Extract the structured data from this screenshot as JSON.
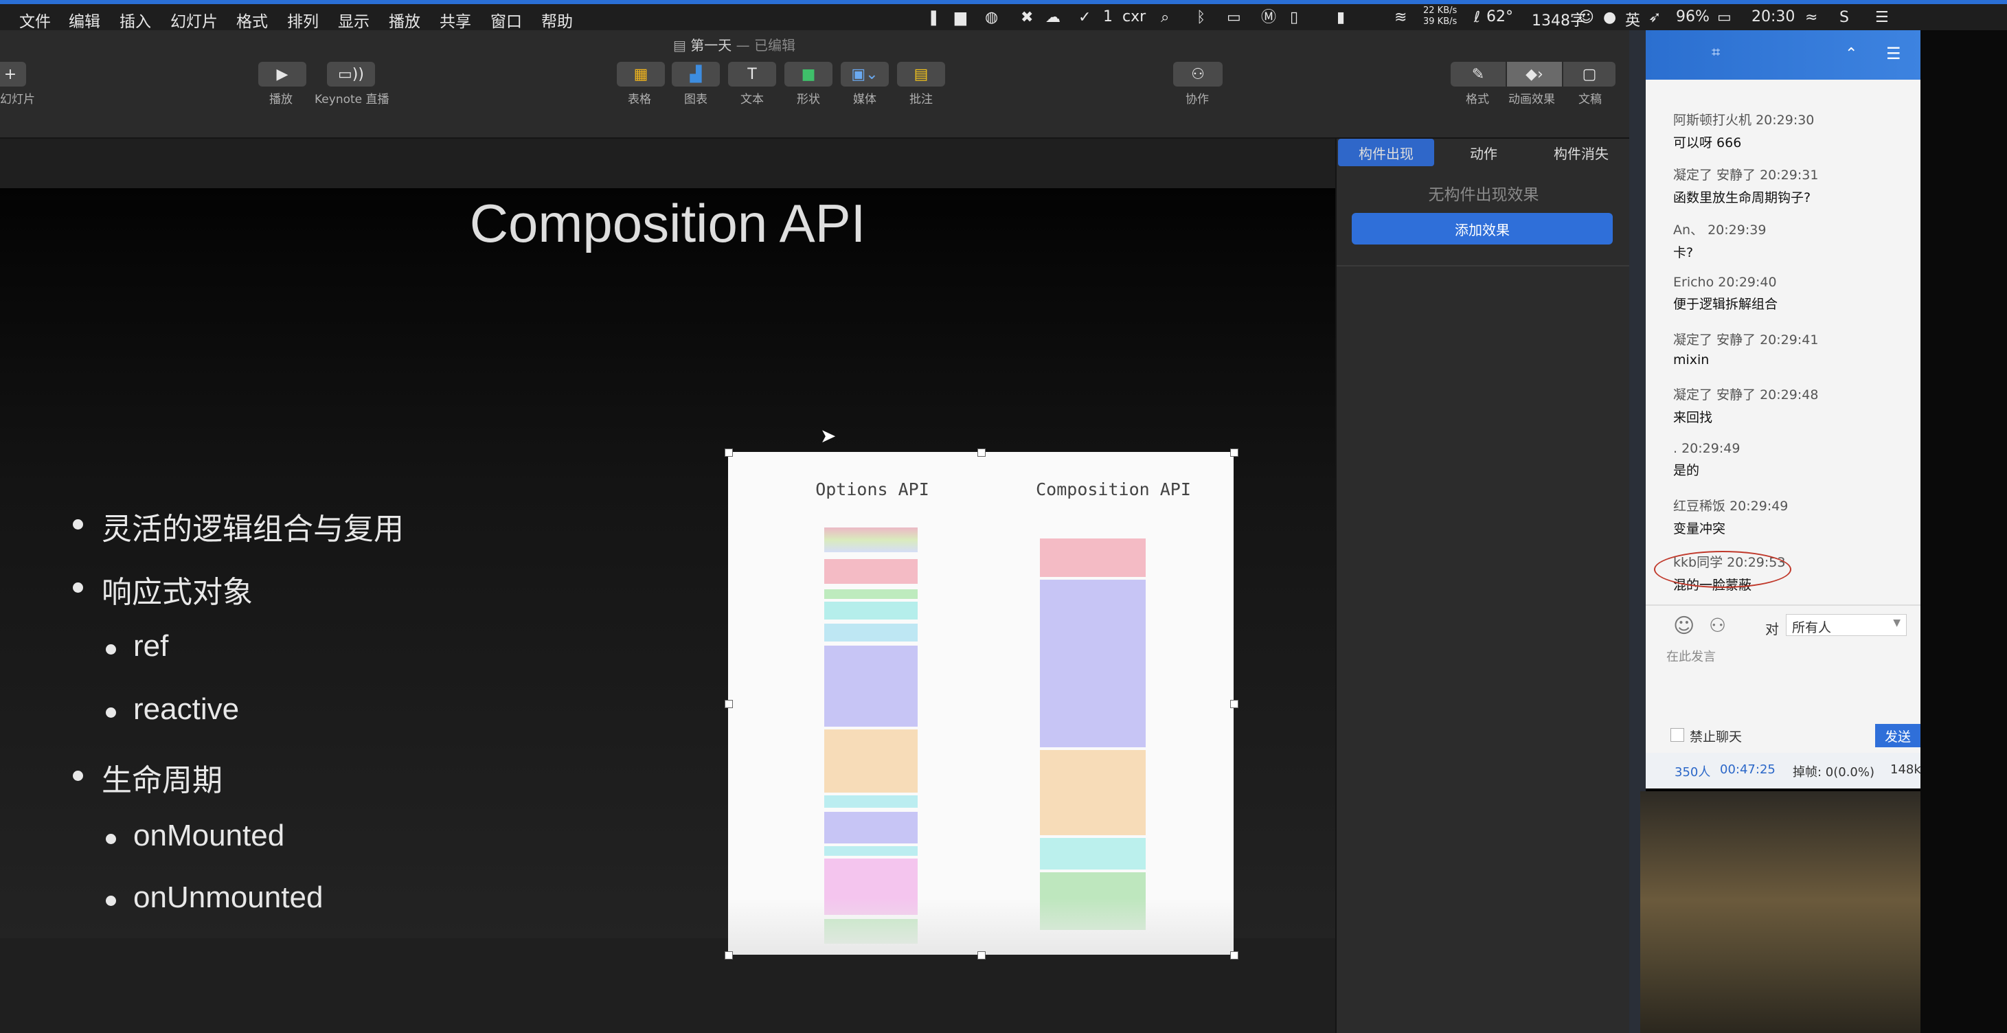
{
  "menubar": {
    "items": [
      "文件",
      "编辑",
      "插入",
      "幻灯片",
      "格式",
      "排列",
      "显示",
      "播放",
      "共享",
      "窗口",
      "帮助"
    ],
    "status": {
      "check_count": "1",
      "user": "cxr",
      "net_up": "22 KB/s",
      "net_down": "39 KB/s",
      "temp": "62°",
      "words": "1348字",
      "ime": "英",
      "battery": "96%",
      "time": "20:30"
    }
  },
  "window": {
    "title": "第一天",
    "edited": "— 已编辑"
  },
  "toolbar": {
    "add_slide": "幻灯片",
    "play": "播放",
    "keynote_live": "Keynote 直播",
    "table": "表格",
    "chart": "图表",
    "text": "文本",
    "shape": "形状",
    "media": "媒体",
    "comment": "批注",
    "collaborate": "协作",
    "format": "格式",
    "animate": "动画效果",
    "document": "文稿"
  },
  "slide": {
    "title": "Composition API",
    "bullets": [
      {
        "text": "灵活的逻辑组合与复用"
      },
      {
        "text": "响应式对象"
      },
      {
        "text": "ref"
      },
      {
        "text": "reactive"
      },
      {
        "text": "生命周期"
      },
      {
        "text": "onMounted"
      },
      {
        "text": "onUnmounted"
      }
    ],
    "figure": {
      "left_title": "Options API",
      "right_title": "Composition API"
    }
  },
  "inspector": {
    "tabs": [
      "构件出现",
      "动作",
      "构件消失"
    ],
    "empty_text": "无构件出现效果",
    "add_button": "添加效果"
  },
  "chat": {
    "messages": [
      {
        "name": "阿斯顿打火机",
        "time": "20:29:30",
        "text": "可以呀 666"
      },
      {
        "name": "凝定了 安静了",
        "time": "20:29:31",
        "text": "函数里放生命周期钩子?"
      },
      {
        "name": "An、",
        "time": "20:29:39",
        "text": "卡?"
      },
      {
        "name": "Ericho",
        "time": "20:29:40",
        "text": "便于逻辑拆解组合"
      },
      {
        "name": "凝定了 安静了",
        "time": "20:29:41",
        "text": "mixin"
      },
      {
        "name": "凝定了 安静了",
        "time": "20:29:48",
        "text": "来回找"
      },
      {
        "name": ".",
        "time": "20:29:49",
        "text": "是的"
      },
      {
        "name": "红豆稀饭",
        "time": "20:29:49",
        "text": "变量冲突"
      },
      {
        "name": "kkb同学",
        "time": "20:29:53",
        "text": "混的一脸蒙蔽"
      }
    ],
    "to_label": "对",
    "recipient": "所有人",
    "input_placeholder": "在此发言",
    "mute_label": "禁止聊天",
    "send": "发送",
    "stats": {
      "viewers": "350人",
      "duration": "00:47:25",
      "dropped": "掉帧: 0(0.0%)",
      "bitrate": "148k"
    }
  },
  "colors": {
    "accent_blue": "#2a6fd6",
    "chat_time_blue": "#2b67c8",
    "highlight_circle": "#c0392b"
  }
}
